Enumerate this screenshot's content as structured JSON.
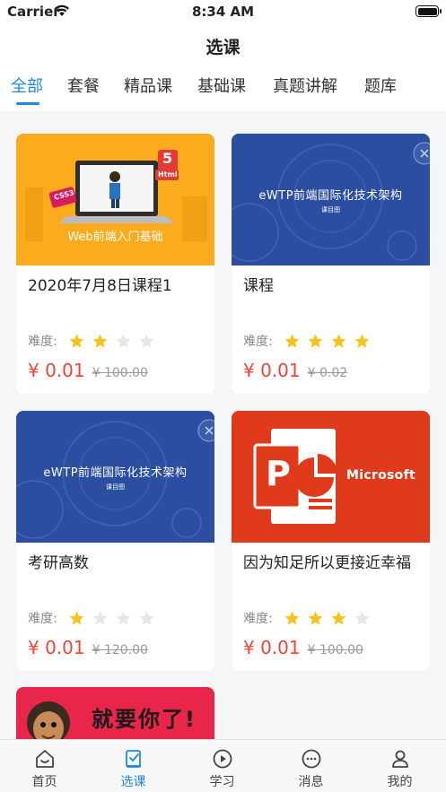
{
  "status_bar": {
    "carrier": "Carrier",
    "time": "8:34 AM"
  },
  "header": {
    "title": "选课"
  },
  "tabs": [
    {
      "label": "全部",
      "active": true
    },
    {
      "label": "套餐",
      "active": false
    },
    {
      "label": "精品课",
      "active": false
    },
    {
      "label": "基础课",
      "active": false
    },
    {
      "label": "真题讲解",
      "active": false
    },
    {
      "label": "题库",
      "active": false
    }
  ],
  "rating_label": "难度:",
  "courses": [
    {
      "title": "2020年7月8日课程1",
      "price": "¥ 0.01",
      "old_price": "¥ 100.00",
      "rating": 2,
      "max_rating": 4,
      "thumb_text": "Web前端入门基础",
      "thumb_badge_1": "5",
      "thumb_badge_2": "Html",
      "thumb_badge_3": "CSS3"
    },
    {
      "title": "课程",
      "price": "¥ 0.01",
      "old_price": "¥ 0.02",
      "rating": 4,
      "max_rating": 4,
      "thumb_text": "eWTP前端国际化技术架构",
      "thumb_sub": "课目图"
    },
    {
      "title": "考研高数",
      "price": "¥ 0.01",
      "old_price": "¥ 120.00",
      "rating": 1,
      "max_rating": 4,
      "thumb_text": "eWTP前端国际化技术架构",
      "thumb_sub": "课目图"
    },
    {
      "title": "因为知足所以更接近幸福",
      "price": "¥ 0.01",
      "old_price": "¥ 100.00",
      "rating": 3,
      "max_rating": 4,
      "thumb_text": "Microsoft",
      "thumb_logo": "P"
    },
    {
      "thumb_text": "就要你了!"
    }
  ],
  "bottom_nav": [
    {
      "label": "首页",
      "icon": "home-smile-icon",
      "active": false
    },
    {
      "label": "选课",
      "icon": "course-select-icon",
      "active": true
    },
    {
      "label": "学习",
      "icon": "play-circle-icon",
      "active": false
    },
    {
      "label": "消息",
      "icon": "chat-bubble-icon",
      "active": false
    },
    {
      "label": "我的",
      "icon": "user-icon",
      "active": false
    }
  ],
  "colors": {
    "accent": "#1e88e5",
    "price": "#f44336",
    "star_on": "#f7c31a",
    "star_off": "#e6e6e6"
  }
}
